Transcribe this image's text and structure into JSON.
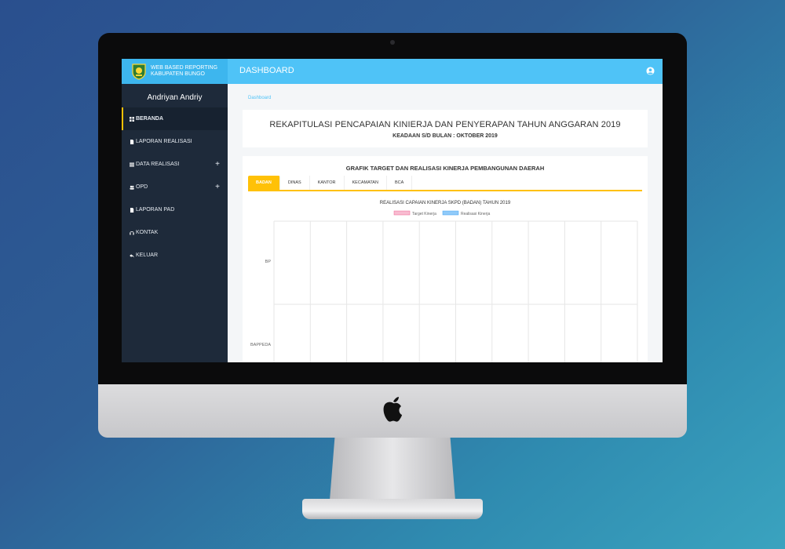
{
  "header": {
    "brand_line1": "WEB BASED REPORTING",
    "brand_line2": "KABUPATEN BUNGO",
    "title": "DASHBOARD"
  },
  "sidebar": {
    "user_name": "Andriyan Andriy",
    "items": [
      {
        "label": "BERANDA",
        "icon": "dashboard-icon",
        "active": true,
        "expandable": false
      },
      {
        "label": "LAPORAN REALISASI",
        "icon": "file-icon",
        "active": false,
        "expandable": false
      },
      {
        "label": "DATA REALISASI",
        "icon": "list-icon",
        "active": false,
        "expandable": true
      },
      {
        "label": "OPD",
        "icon": "users-icon",
        "active": false,
        "expandable": true
      },
      {
        "label": "LAPORAN PAD",
        "icon": "file-icon",
        "active": false,
        "expandable": false
      },
      {
        "label": "KONTAK",
        "icon": "headset-icon",
        "active": false,
        "expandable": false
      },
      {
        "label": "KELUAR",
        "icon": "reply-icon",
        "active": false,
        "expandable": false
      }
    ]
  },
  "breadcrumb": "Dashboard",
  "report": {
    "title": "REKAPITULASI PENCAPAIAN KINIERJA DAN PENYERAPAN TAHUN ANGGARAN 2019",
    "subtitle": "KEADAAN S/D BULAN : OKTOBER 2019"
  },
  "chart_section": {
    "heading": "GRAFIK TARGET DAN REALISASI KINERJA PEMBANGUNAN DAERAH",
    "tabs": [
      "BADAN",
      "DINAS",
      "KANTOR",
      "KECAMATAN",
      "BCA"
    ],
    "active_tab": "BADAN"
  },
  "colors": {
    "topbar": "#4fc3f7",
    "sidebar": "#1e2a3a",
    "accent": "#ffc107",
    "target_series": "#f8bbd0",
    "realisasi_series": "#90caf9"
  },
  "chart_data": {
    "type": "bar",
    "orientation": "horizontal",
    "title": "REALISASI CAPAIAN KINERJA SKPD (BADAN) TAHUN 2019",
    "categories": [
      "BP",
      "BAPPEDA"
    ],
    "series": [
      {
        "name": "Target Kinerja",
        "color": "#f8bbd0",
        "values": [
          0,
          0
        ]
      },
      {
        "name": "Realisasi Kinerja",
        "color": "#90caf9",
        "values": [
          0,
          0
        ]
      }
    ],
    "legend_position": "top",
    "grid": true,
    "vertical_gridlines": 10
  }
}
